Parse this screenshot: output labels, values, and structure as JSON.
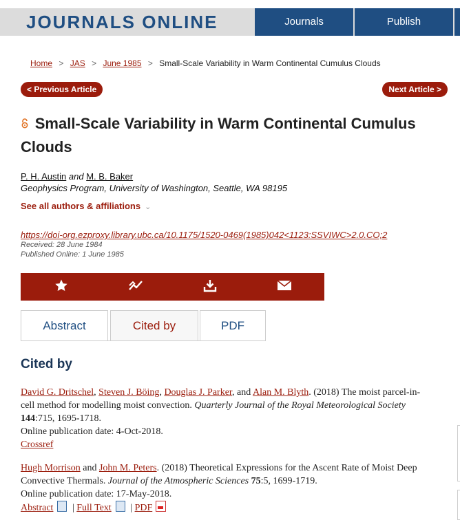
{
  "header": {
    "brand": "JOURNALS ONLINE",
    "nav": [
      "Journals",
      "Publish"
    ]
  },
  "breadcrumb": {
    "items": [
      "Home",
      "JAS",
      "June 1985"
    ],
    "current": "Small-Scale Variability in Warm Continental Cumulus Clouds",
    "separator": ">"
  },
  "pager": {
    "prev": "< Previous Article",
    "next": "Next Article >"
  },
  "article": {
    "title": "Small-Scale Variability in Warm Continental Cumulus Clouds",
    "author1": "P. H. Austin",
    "and": "and",
    "author2": "M. B. Baker",
    "affiliation": "Geophysics Program, University of Washington, Seattle, WA 98195",
    "see_all": "See all authors & affiliations",
    "doi": "https://doi-org.ezproxy.library.ubc.ca/10.1175/1520-0469(1985)042<1123:SSVIWC>2.0.CO;2",
    "received": "Received: 28 June 1984",
    "published": "Published Online: 1 June 1985"
  },
  "toolbar": {
    "icons": [
      "star-icon",
      "metrics-icon",
      "download-icon",
      "email-icon"
    ]
  },
  "tabs": [
    "Abstract",
    "Cited by",
    "PDF"
  ],
  "cited_by": {
    "heading": "Cited by",
    "items": [
      {
        "a1": "David G. Dritschel",
        "a2": "Steven J. Böing",
        "a3": "Douglas J. Parker",
        "and": "and",
        "a4": "Alan M. Blyth",
        "text": ". (2018) The moist parcel-in-cell method for modelling moist convection. ",
        "journal": "Quarterly Journal of the Royal Meteorological Society",
        "volume": "144",
        "pages": ":715, 1695-1718.",
        "online": "Online publication date: 4-Oct-2018.",
        "link": "Crossref"
      },
      {
        "a1": "Hugh Morrison",
        "and": "and",
        "a2": "John M. Peters",
        "text": ". (2018) Theoretical Expressions for the Ascent Rate of Moist Deep Convective Thermals. ",
        "journal": "Journal of the Atmospheric Sciences",
        "volume": "75",
        "pages": ":5, 1699-1719.",
        "online": "Online publication date: 17-May-2018.",
        "links": [
          "Abstract",
          "Full Text",
          "PDF"
        ],
        "link_sep": "|"
      }
    ]
  },
  "colors": {
    "accent": "#9b1c0c",
    "brand": "#1f4e82",
    "bar": "#dcdcdc"
  }
}
